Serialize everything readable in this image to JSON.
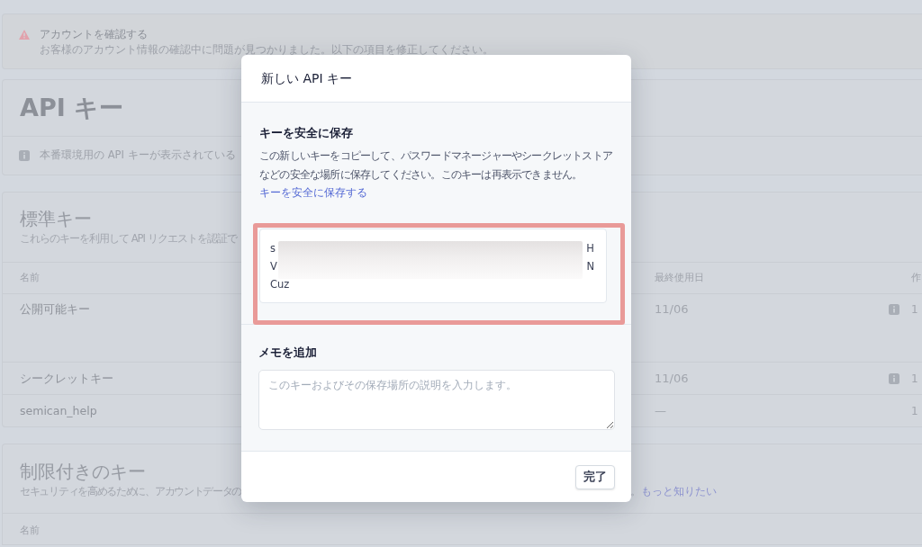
{
  "alert": {
    "title": "アカウントを確認する",
    "message": "お客様のアカウント情報の確認中に問題が見つかりました。以下の項目を修正してください。"
  },
  "api_keys": {
    "title": "API キー",
    "notice": "本番環境用の API キーが表示されている"
  },
  "standard_keys": {
    "title": "標準キー",
    "description": "これらのキーを利用して API リクエストを認証で",
    "columns": [
      "名前",
      "最終使用日",
      "作"
    ],
    "rows": [
      {
        "name": "公開可能キー",
        "last_used": "11/06",
        "has_info": true,
        "column_3": "1"
      },
      {
        "name": "シークレットキー",
        "last_used": "11/06",
        "has_info": true,
        "column_3": "1"
      },
      {
        "name": "semican_help",
        "last_used": "—",
        "has_info": false,
        "column_3": "1"
      }
    ]
  },
  "restricted_keys": {
    "title": "制限付きのキー",
    "description": "セキュリティを高めるために、アカウントデータの",
    "description_tail": "。",
    "link": "もっと知りたい",
    "columns": [
      "名前"
    ]
  },
  "modal": {
    "title": "新しい API キー",
    "save_heading": "キーを安全に保存",
    "save_text": "この新しいキーをコピーして、パスワードマネージャーやシークレットストアなどの安全な場所に保存してください。このキーは再表示できません。",
    "save_link": "キーを安全に保存する",
    "key_lines": [
      {
        "start": "s",
        "end": "H"
      },
      {
        "start": "V",
        "end": "N"
      },
      {
        "start": "Cuz"
      }
    ],
    "note_label": "メモを追加",
    "note_placeholder": "このキーおよびその保存場所の説明を入力します。",
    "buttons": [
      "完了"
    ]
  }
}
